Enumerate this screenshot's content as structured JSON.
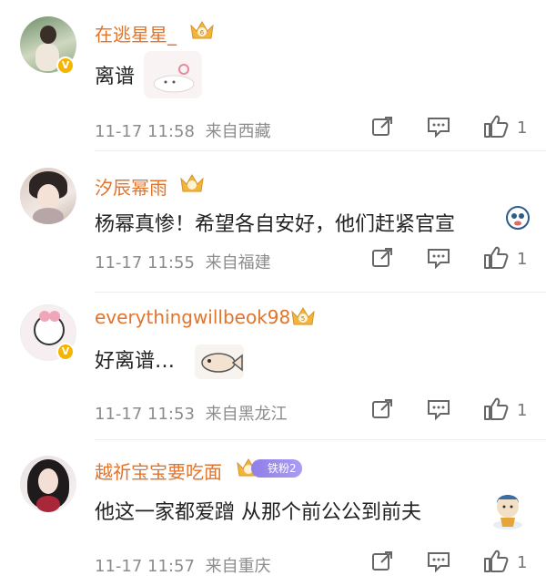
{
  "comments": [
    {
      "username": "在逃星星_",
      "text": "离谱",
      "time": "11-17 11:58",
      "location": "来自西藏",
      "likes": "1",
      "verified": true
    },
    {
      "username": "汐辰幂雨",
      "text": "杨幂真惨！希望各自安好，他们赶紧官宣",
      "time": "11-17 11:55",
      "location": "来自福建",
      "likes": "1",
      "verified": false
    },
    {
      "username": "everythingwillbeok98",
      "text": "好离谱…",
      "time": "11-17 11:53",
      "location": "来自黑龙江",
      "likes": "1",
      "verified": true
    },
    {
      "username": "越祈宝宝要吃面",
      "fan_badge": "铁粉2",
      "text": "他这一家都爱蹭 从那个前公公到前夫",
      "time": "11-17 11:57",
      "location": "来自重庆",
      "likes": "1",
      "verified": false
    }
  ],
  "colors": {
    "username": "#e2742c",
    "meta": "#8c8c8c",
    "verified_badge": "#f4b400",
    "crown": "#f2b43a"
  },
  "icons": [
    "share-icon",
    "comment-icon",
    "like-icon",
    "crown-badge-icon",
    "verified-icon"
  ]
}
